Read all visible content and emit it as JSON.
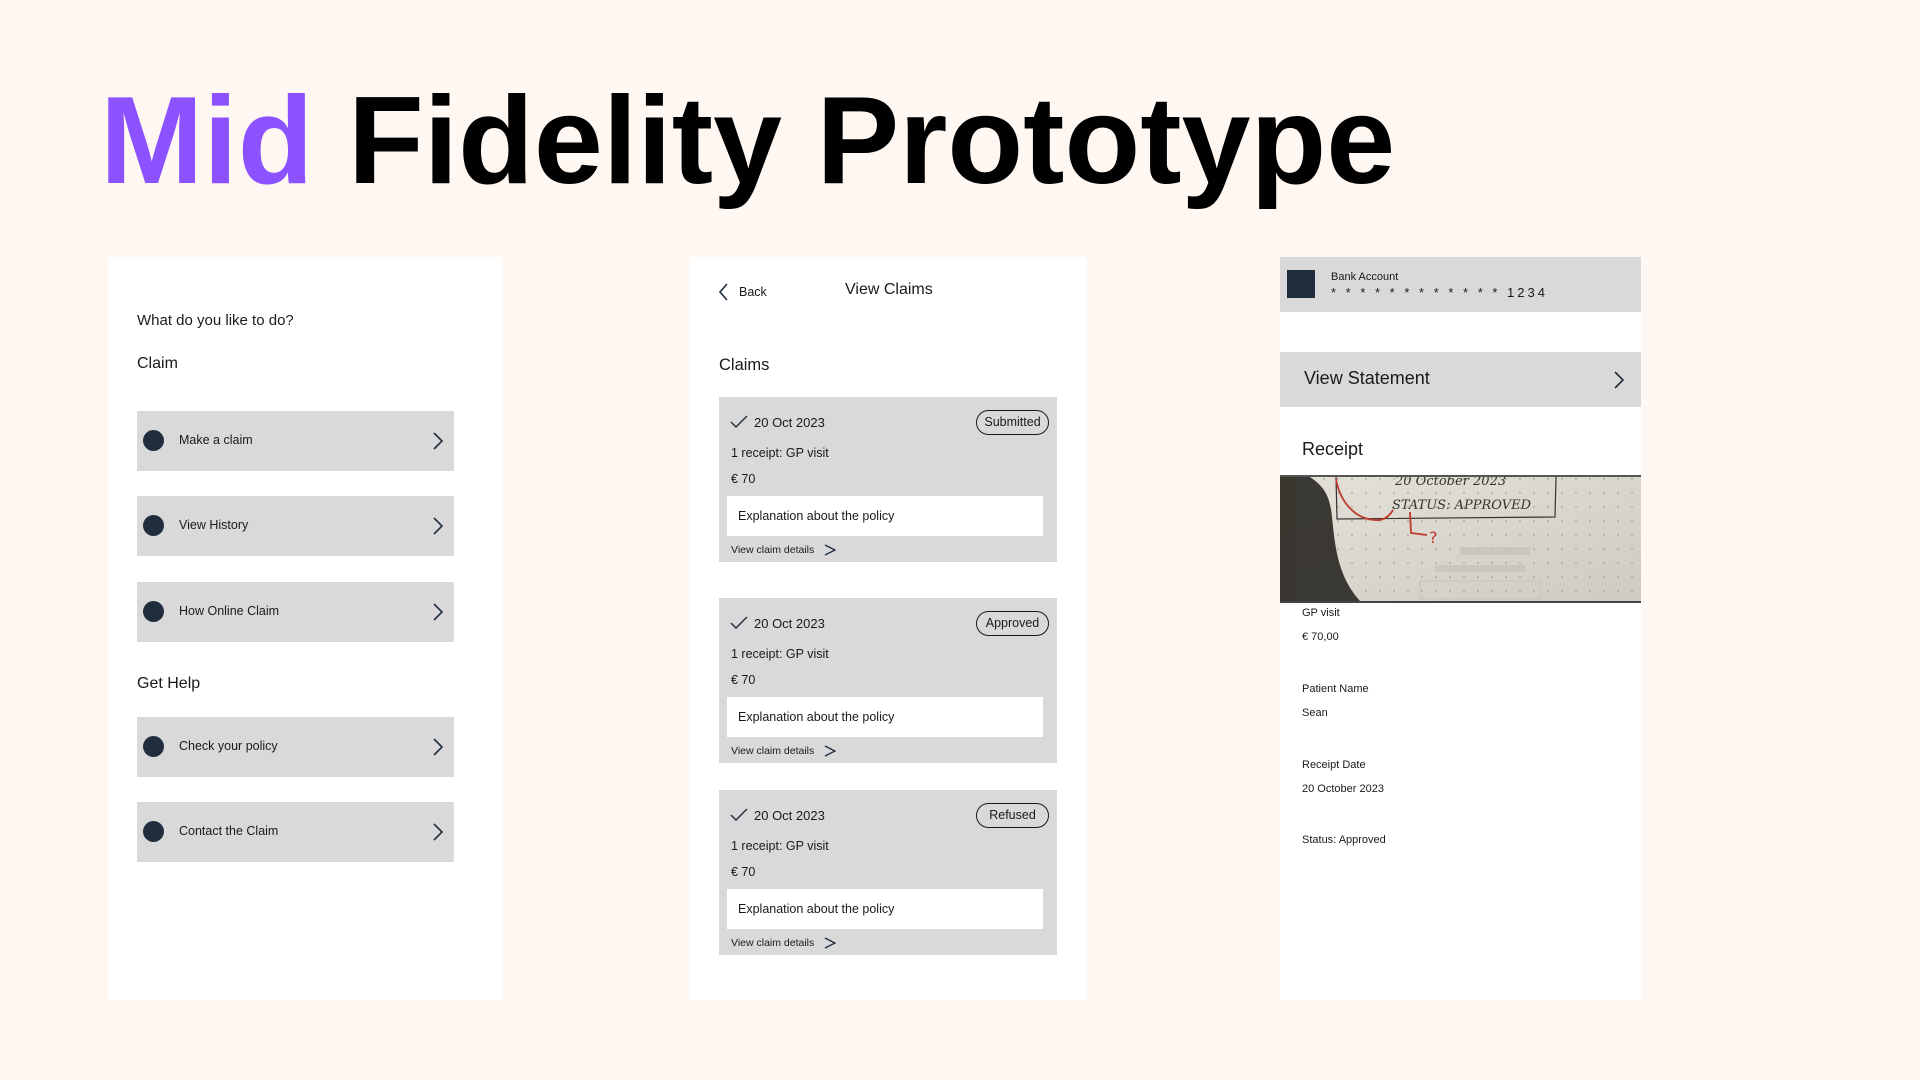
{
  "title": {
    "accent_word": "Mid",
    "rest": "Fidelity Prototype",
    "accent_color": "#8c52ff"
  },
  "colors": {
    "background": "#fff7f2",
    "panel": "#ffffff",
    "tile": "#d9d9d9",
    "icon_dark": "#1f2d3d"
  },
  "home_screen": {
    "question": "What do you like to do?",
    "sections": [
      {
        "heading": "Claim",
        "items": [
          {
            "label": "Make a claim",
            "icon": "circle-bullet-icon"
          },
          {
            "label": "View History",
            "icon": "circle-bullet-icon"
          },
          {
            "label": "How Online Claim",
            "icon": "circle-bullet-icon"
          }
        ]
      },
      {
        "heading": "Get Help",
        "items": [
          {
            "label": "Check your policy",
            "icon": "circle-bullet-icon"
          },
          {
            "label": "Contact the Claim",
            "icon": "circle-bullet-icon"
          }
        ]
      }
    ]
  },
  "claims_screen": {
    "back_label": "Back",
    "title": "View Claims",
    "section_heading": "Claims",
    "claims": [
      {
        "date": "20 Oct 2023",
        "status": "Submitted",
        "receipt": "1 receipt: GP visit",
        "amount": "€ 70",
        "explanation": "Explanation about the policy",
        "details_link": "View claim details"
      },
      {
        "date": "20 Oct 2023",
        "status": "Approved",
        "receipt": "1 receipt: GP visit",
        "amount": "€ 70",
        "explanation": "Explanation about the policy",
        "details_link": "View claim details"
      },
      {
        "date": "20 Oct 2023",
        "status": "Refused",
        "receipt": "1 receipt: GP visit",
        "amount": "€ 70",
        "explanation": "Explanation about the policy",
        "details_link": "View claim details"
      }
    ]
  },
  "receipt_screen": {
    "bank_label": "Bank Account",
    "bank_number": "**** **** **** 1234",
    "view_statement": "View Statement",
    "receipt_heading": "Receipt",
    "receipt_photo_text": {
      "line1": "20 October 2023",
      "line2": "STATUS: APPROVED",
      "annotation": "?"
    },
    "details": [
      {
        "label": "GP visit",
        "value": "€ 70,00"
      },
      {
        "label": "Patient Name",
        "value": "Sean"
      },
      {
        "label": "Receipt Date",
        "value": "20 October 2023"
      }
    ],
    "status_line": "Status: Approved"
  }
}
